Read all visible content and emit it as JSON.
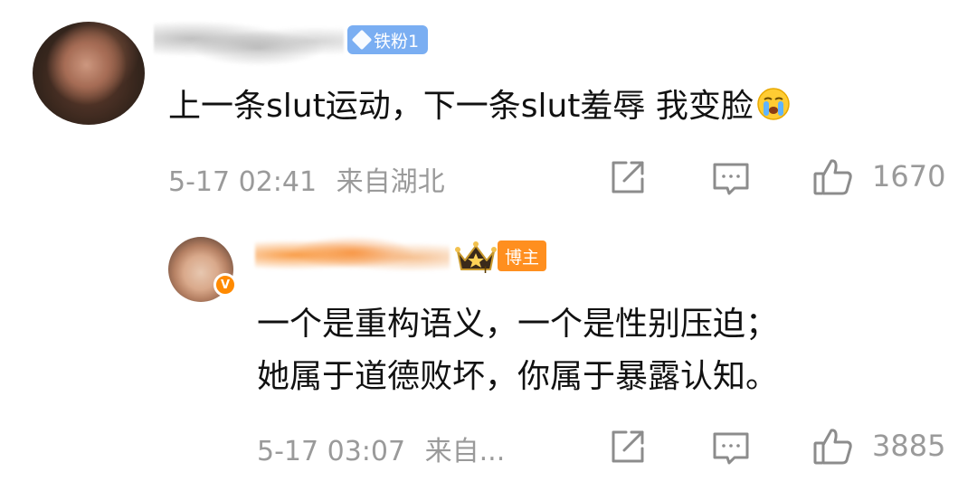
{
  "comment": {
    "username": "",
    "fan_badge": "铁粉1",
    "text": "上一条slut运动，下一条slut羞辱 我变脸",
    "emoji": "crying-face",
    "timestamp": "5-17 02:41",
    "location": "来自湖北",
    "likes": "1670"
  },
  "reply": {
    "username": "",
    "role_badge": "博主",
    "verified": "V",
    "crown_level": "I",
    "text_line1": "一个是重构语义，一个是性别压迫；",
    "text_line2": "她属于道德败坏，你属于暴露认知。",
    "timestamp": "5-17 03:07",
    "location": "来自...",
    "likes": "3885"
  },
  "colors": {
    "fan_badge_bg": "#7aaef2",
    "blogger_badge_bg": "#ff8f1f",
    "meta_text": "#9a9a9a",
    "icon_stroke": "#8c8c8c"
  },
  "icons": [
    "share-icon",
    "comment-icon",
    "like-icon",
    "diamond-icon",
    "crown-icon",
    "crying-emoji-icon",
    "verified-icon"
  ]
}
